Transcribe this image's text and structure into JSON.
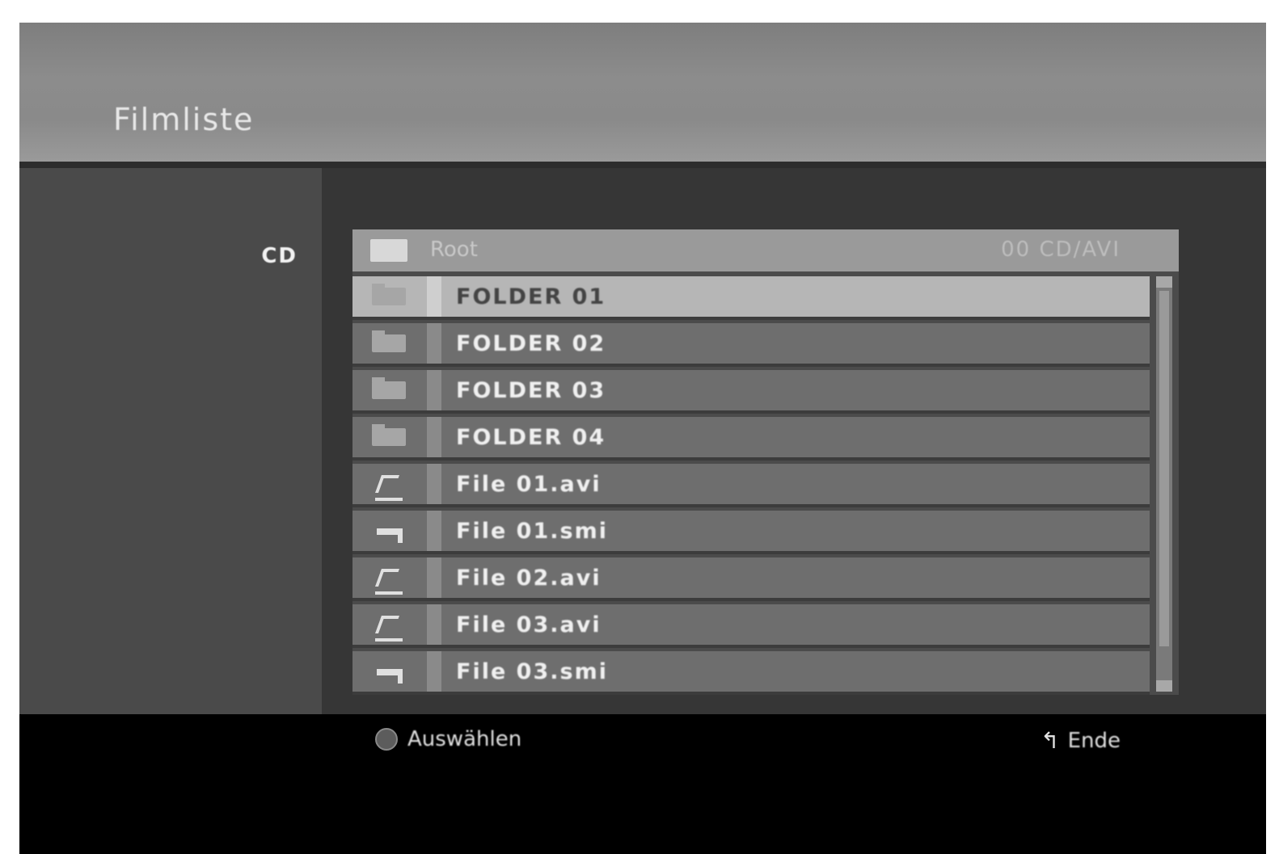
{
  "header": {
    "title": "Filmliste"
  },
  "sidebar": {
    "source_label": "CD"
  },
  "list": {
    "header": {
      "name": "Root",
      "free_space": "00 CD/AVI"
    },
    "rows": [
      {
        "name": "FOLDER 01",
        "icon": "folder-icon"
      },
      {
        "name": "FOLDER 02",
        "icon": "folder-icon"
      },
      {
        "name": "FOLDER 03",
        "icon": "folder-icon"
      },
      {
        "name": "FOLDER 04",
        "icon": "folder-icon"
      },
      {
        "name": "File 01.avi",
        "icon": "movie-file-icon"
      },
      {
        "name": "File 01.smi",
        "icon": "subtitle-file-icon"
      },
      {
        "name": "File 02.avi",
        "icon": "movie-file-icon"
      },
      {
        "name": "File 03.avi",
        "icon": "movie-file-icon"
      },
      {
        "name": "File 03.smi",
        "icon": "subtitle-file-icon"
      }
    ],
    "selected_index": 0
  },
  "footer": {
    "left_hint": "Auswählen",
    "right_hint": "Ende",
    "return_symbol": "↰"
  },
  "colors": {
    "background": "#000000",
    "selected_row": "#b6b6b6",
    "row": "#6e6e6e"
  }
}
